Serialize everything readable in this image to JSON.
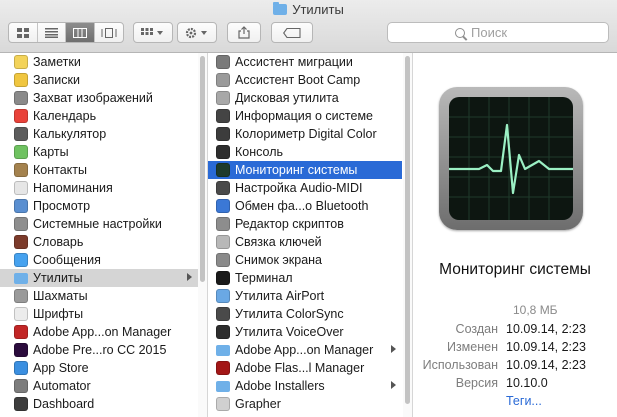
{
  "window": {
    "title": "Утилиты"
  },
  "toolbar": {
    "view_icons": [
      "icon-view-icon",
      "list-view-icon",
      "column-view-icon",
      "coverflow-view-icon"
    ],
    "search_placeholder": "Поиск"
  },
  "sidebar_column": {
    "items": [
      {
        "label": "Заметки",
        "icon": "notes-icon",
        "color": "#f3d35a"
      },
      {
        "label": "Записки",
        "icon": "stickies-icon",
        "color": "#f0c640"
      },
      {
        "label": "Захват изображений",
        "icon": "image-capture-icon",
        "color": "#8a8a8a"
      },
      {
        "label": "Календарь",
        "icon": "calendar-icon",
        "color": "#e9423a"
      },
      {
        "label": "Калькулятор",
        "icon": "calculator-icon",
        "color": "#5d5d5d"
      },
      {
        "label": "Карты",
        "icon": "maps-icon",
        "color": "#6fc261"
      },
      {
        "label": "Контакты",
        "icon": "contacts-icon",
        "color": "#a4824e"
      },
      {
        "label": "Напоминания",
        "icon": "reminders-icon",
        "color": "#e6e6e6"
      },
      {
        "label": "Просмотр",
        "icon": "preview-icon",
        "color": "#5a8fd1"
      },
      {
        "label": "Системные настройки",
        "icon": "system-preferences-icon",
        "color": "#8e8e8e"
      },
      {
        "label": "Словарь",
        "icon": "dictionary-icon",
        "color": "#7c3b2b"
      },
      {
        "label": "Сообщения",
        "icon": "messages-icon",
        "color": "#46a2ef"
      },
      {
        "label": "Утилиты",
        "icon": "utilities-folder-icon",
        "color": "#6fb0e8",
        "selected": true,
        "folder": true
      },
      {
        "label": "Шахматы",
        "icon": "chess-icon",
        "color": "#9a9a9a"
      },
      {
        "label": "Шрифты",
        "icon": "font-book-icon",
        "color": "#ececec"
      },
      {
        "label": "Adobe App...on Manager",
        "icon": "adobe-application-manager-icon",
        "color": "#c22626"
      },
      {
        "label": "Adobe Pre...ro CC 2015",
        "icon": "adobe-premiere-icon",
        "color": "#2b0c3d"
      },
      {
        "label": "App Store",
        "icon": "app-store-icon",
        "color": "#3b8fe0"
      },
      {
        "label": "Automator",
        "icon": "automator-icon",
        "color": "#7d7d7d"
      },
      {
        "label": "Dashboard",
        "icon": "dashboard-icon",
        "color": "#3d3d3d"
      }
    ]
  },
  "utilities_column": {
    "items": [
      {
        "label": "Ассистент миграции",
        "icon": "migration-assistant-icon",
        "color": "#7a7a7a"
      },
      {
        "label": "Ассистент Boot Camp",
        "icon": "boot-camp-icon",
        "color": "#9a9a9a"
      },
      {
        "label": "Дисковая утилита",
        "icon": "disk-utility-icon",
        "color": "#a8a8a8"
      },
      {
        "label": "Информация о системе",
        "icon": "system-information-icon",
        "color": "#444444"
      },
      {
        "label": "Колориметр Digital Color",
        "icon": "digital-color-meter-icon",
        "color": "#3c3c3c"
      },
      {
        "label": "Консоль",
        "icon": "console-icon",
        "color": "#2e2e2e"
      },
      {
        "label": "Мониторинг системы",
        "icon": "activity-monitor-icon",
        "color": "#1e3b2c",
        "active": true
      },
      {
        "label": "Настройка Audio-MIDI",
        "icon": "audio-midi-setup-icon",
        "color": "#4a4a4a"
      },
      {
        "label": "Обмен фа...о Bluetooth",
        "icon": "bluetooth-file-exchange-icon",
        "color": "#3b78d6"
      },
      {
        "label": "Редактор скриптов",
        "icon": "script-editor-icon",
        "color": "#8d8d8d"
      },
      {
        "label": "Связка ключей",
        "icon": "keychain-access-icon",
        "color": "#b8b8b8"
      },
      {
        "label": "Снимок экрана",
        "icon": "grab-icon",
        "color": "#8a8a8a"
      },
      {
        "label": "Терминал",
        "icon": "terminal-icon",
        "color": "#1a1a1a"
      },
      {
        "label": "Утилита AirPort",
        "icon": "airport-utility-icon",
        "color": "#6aa8e4"
      },
      {
        "label": "Утилита ColorSync",
        "icon": "colorsync-utility-icon",
        "color": "#4a4a4a"
      },
      {
        "label": "Утилита VoiceOver",
        "icon": "voiceover-utility-icon",
        "color": "#2d2d2d"
      },
      {
        "label": "Adobe App...on Manager",
        "icon": "folder-icon",
        "color": "#6fb0e8",
        "folder": true
      },
      {
        "label": "Adobe Flas...l Manager",
        "icon": "adobe-flash-icon",
        "color": "#a31717"
      },
      {
        "label": "Adobe Installers",
        "icon": "folder-icon",
        "color": "#6fb0e8",
        "folder": true
      },
      {
        "label": "Grapher",
        "icon": "grapher-icon",
        "color": "#d0d0d0"
      }
    ]
  },
  "preview": {
    "app_name": "Мониторинг системы",
    "size": "10,8 МБ",
    "created_label": "Создан",
    "created": "10.09.14, 2:23",
    "modified_label": "Изменен",
    "modified": "10.09.14, 2:23",
    "last_opened_label": "Использован",
    "last_opened": "10.09.14, 2:23",
    "version_label": "Версия",
    "version": "10.10.0",
    "tags_link": "Теги..."
  }
}
